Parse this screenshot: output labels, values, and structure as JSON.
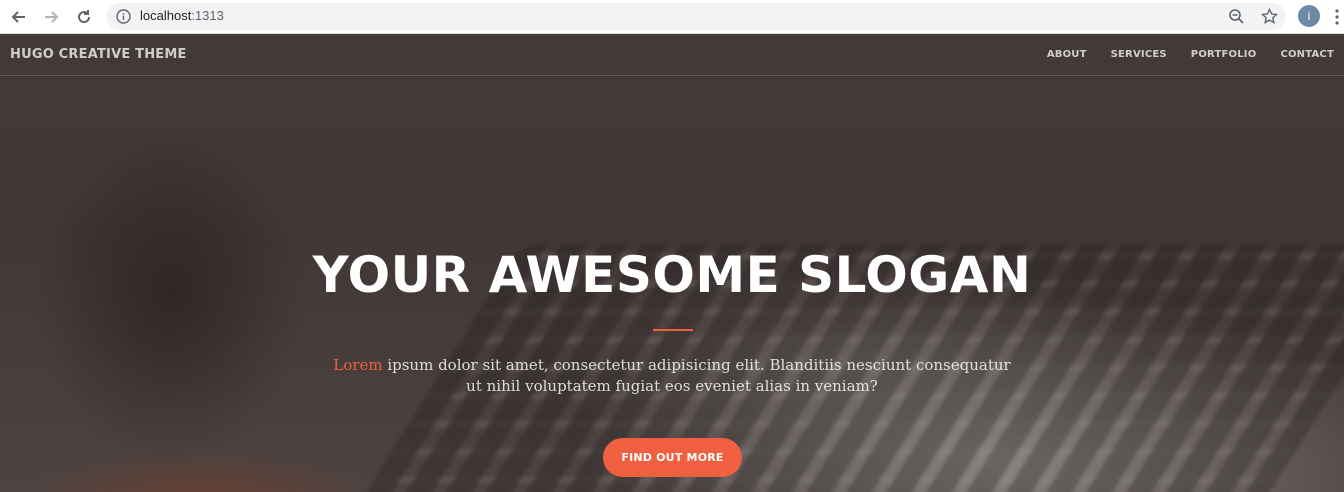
{
  "browser": {
    "url_host": "localhost",
    "url_port": ":1313",
    "profile_initial": "i"
  },
  "nav": {
    "brand": "HUGO CREATIVE THEME",
    "links": [
      "ABOUT",
      "SERVICES",
      "PORTFOLIO",
      "CONTACT"
    ]
  },
  "hero": {
    "slogan": "YOUR AWESOME SLOGAN",
    "lead_accent": "Lorem",
    "lead_rest": " ipsum dolor sit amet, consectetur adipisicing elit. Blanditiis nesciunt consequatur ut nihil voluptatem fugiat eos eveniet alias in veniam?",
    "cta_label": "FIND OUT MORE"
  },
  "colors": {
    "accent": "#f05f40"
  }
}
